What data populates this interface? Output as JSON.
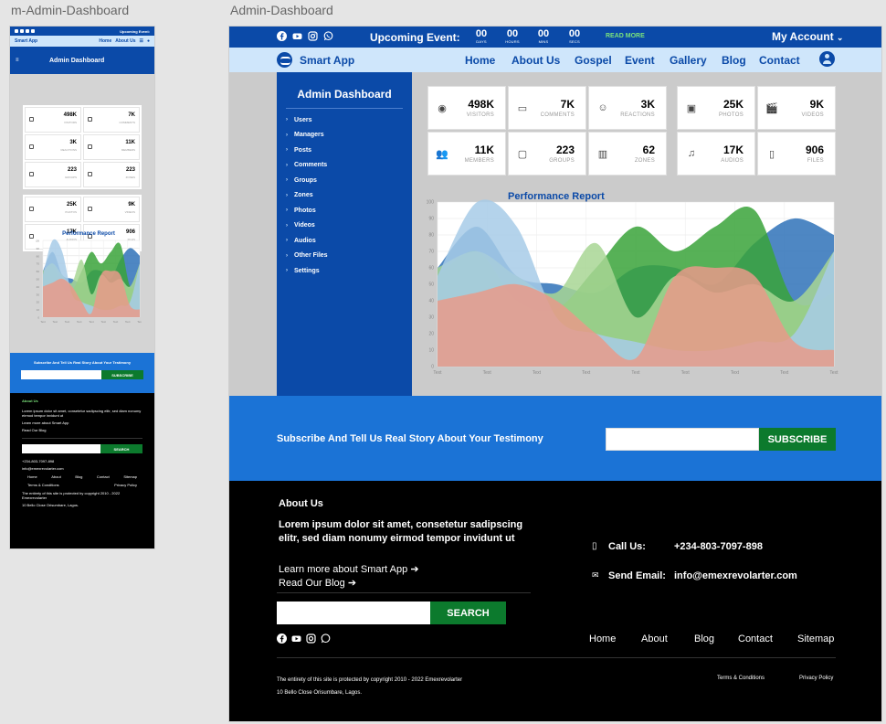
{
  "frames": {
    "mobile_label": "m-Admin-Dashboard",
    "desktop_label": "Admin-Dashboard"
  },
  "topbar": {
    "event_label": "Upcoming Event:",
    "countdown": [
      {
        "value": "00",
        "unit": "DAYS"
      },
      {
        "value": "00",
        "unit": "HOURS"
      },
      {
        "value": "00",
        "unit": "MINS"
      },
      {
        "value": "00",
        "unit": "SECS"
      }
    ],
    "read_more": "READ MORE",
    "account": "My Account",
    "account_caret": "⌄",
    "social_icons": [
      "facebook-icon",
      "youtube-icon",
      "instagram-icon",
      "whatsapp-icon"
    ]
  },
  "nav": {
    "brand": "Smart App",
    "links": [
      "Home",
      "About Us",
      "Gospel",
      "Event",
      "Gallery",
      "Blog",
      "Contact"
    ],
    "mobile_links": [
      "Home",
      "About Us"
    ]
  },
  "sidebar": {
    "title": "Admin Dashboard",
    "items": [
      "Users",
      "Managers",
      "Posts",
      "Comments",
      "Groups",
      "Zones",
      "Photos",
      "Videos",
      "Audios",
      "Other Files",
      "Settings"
    ]
  },
  "stats": [
    {
      "value": "498K",
      "label": "VISITORS",
      "icon": "eye-icon"
    },
    {
      "value": "7K",
      "label": "COMMENTS",
      "icon": "comment-icon"
    },
    {
      "value": "3K",
      "label": "REACTIONS",
      "icon": "smile-icon"
    },
    {
      "value": "25K",
      "label": "PHOTOS",
      "icon": "image-icon"
    },
    {
      "value": "9K",
      "label": "VIDEOS",
      "icon": "clapper-icon"
    },
    {
      "value": "11K",
      "label": "MEMBERS",
      "icon": "members-icon"
    },
    {
      "value": "223",
      "label": "GROUPS",
      "icon": "group-icon"
    },
    {
      "value": "62",
      "label": "ZONES",
      "icon": "building-icon"
    },
    {
      "value": "17K",
      "label": "AUDIOS",
      "icon": "music-icon"
    },
    {
      "value": "906",
      "label": "FILES",
      "icon": "file-icon"
    }
  ],
  "mobile_stats": [
    {
      "value": "498K",
      "label": "VISITORS"
    },
    {
      "value": "7K",
      "label": "COMMENTS"
    },
    {
      "value": "3K",
      "label": "REACTIONS"
    },
    {
      "value": "11K",
      "label": "MEMBERS"
    },
    {
      "value": "223",
      "label": "GROUPS"
    },
    {
      "value": "223",
      "label": "ZONES"
    },
    {
      "value": "25K",
      "label": "PHOTOS"
    },
    {
      "value": "9K",
      "label": "VIDEOS"
    },
    {
      "value": "17K",
      "label": "AUDIOS"
    },
    {
      "value": "906",
      "label": "FILES"
    }
  ],
  "chart_data": {
    "type": "area",
    "title": "Performance Report",
    "x": [
      "Text",
      "Text",
      "Text",
      "Text",
      "Text",
      "Text",
      "Text",
      "Text",
      "Text"
    ],
    "ylim": [
      0,
      100
    ],
    "yticks": [
      0,
      10,
      20,
      30,
      40,
      50,
      60,
      70,
      80,
      90,
      100
    ],
    "grid": true,
    "series": [
      {
        "color": "#2f72b8",
        "values": [
          60,
          85,
          55,
          50,
          45,
          60,
          60,
          50,
          75,
          90,
          80
        ]
      },
      {
        "color": "#39a33a",
        "values": [
          55,
          70,
          40,
          35,
          60,
          85,
          70,
          85,
          95,
          40,
          45
        ]
      },
      {
        "color": "#a8d694",
        "values": [
          60,
          70,
          55,
          45,
          75,
          30,
          55,
          45,
          50,
          40,
          70
        ]
      },
      {
        "color": "#a7cbe8",
        "values": [
          55,
          100,
          85,
          30,
          20,
          15,
          10,
          10,
          15,
          20,
          70
        ]
      },
      {
        "color": "#e89a8a",
        "values": [
          40,
          45,
          50,
          40,
          20,
          5,
          55,
          60,
          55,
          15,
          10
        ]
      }
    ]
  },
  "subscribe": {
    "text": "Subscribe And Tell Us Real Story About Your Testimony",
    "button": "SUBSCRIBE"
  },
  "footer": {
    "about_title": "About Us",
    "about_text": "Lorem ipsum dolor sit amet, consetetur sadipscing elitr, sed diam nonumy eirmod tempor invidunt ut",
    "learn_more": "Learn more about Smart App",
    "read_blog": "Read Our Blog",
    "search_button": "SEARCH",
    "call_label": "Call Us:",
    "call_value": "+234-803-7097-898",
    "email_label": "Send Email:",
    "email_value": "info@emexrevolarter.com",
    "links": [
      "Home",
      "About",
      "Blog",
      "Contact",
      "Sitemap"
    ],
    "copyright": "The entirety of this site is protected by copyright  2010 - 2022 Emexrevolarter",
    "address": "10 Bello Close Orisumbare, Lagos.",
    "terms": "Terms & Conditions",
    "privacy": "Privacy Policy"
  }
}
